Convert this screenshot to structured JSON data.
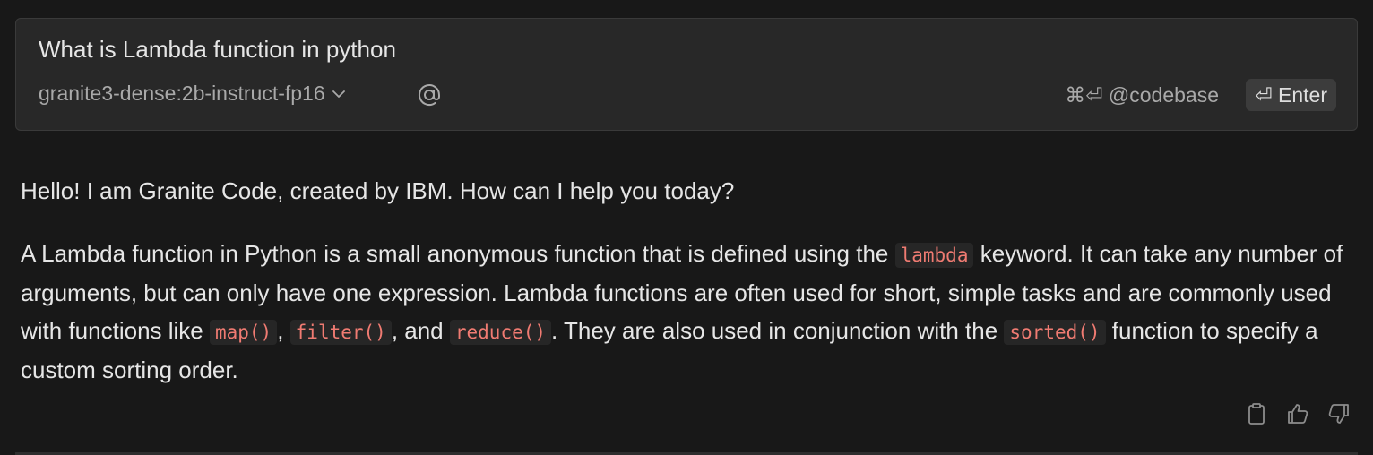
{
  "prompt": {
    "text": "What is Lambda function in python"
  },
  "toolbar": {
    "model": "granite3-dense:2b-instruct-fp16",
    "mention_icon": "at-icon",
    "codebase_hint": "⌘⏎ @codebase",
    "enter_label": "⏎ Enter"
  },
  "response": {
    "greeting": "Hello! I am Granite Code, created by IBM. How can I help you today?",
    "seg1": "A Lambda function in Python is a small anonymous function that is defined using the ",
    "code1": "lambda",
    "seg2": " keyword. It can take any number of arguments, but can only have one expression. Lambda functions are often used for short, simple tasks and are commonly used with functions like ",
    "code2": "map()",
    "seg3": ", ",
    "code3": "filter()",
    "seg4": ", and ",
    "code4": "reduce()",
    "seg5": ". They are also used in conjunction with the ",
    "code5": "sorted()",
    "seg6": " function to specify a custom sorting order."
  },
  "actions": {
    "icons": [
      "clipboard-icon",
      "thumbs-up-icon",
      "thumbs-down-icon"
    ]
  },
  "colors": {
    "background": "#181818",
    "input_background": "#282828",
    "code_text": "#f07b72",
    "muted_text": "#a9a9a9"
  }
}
